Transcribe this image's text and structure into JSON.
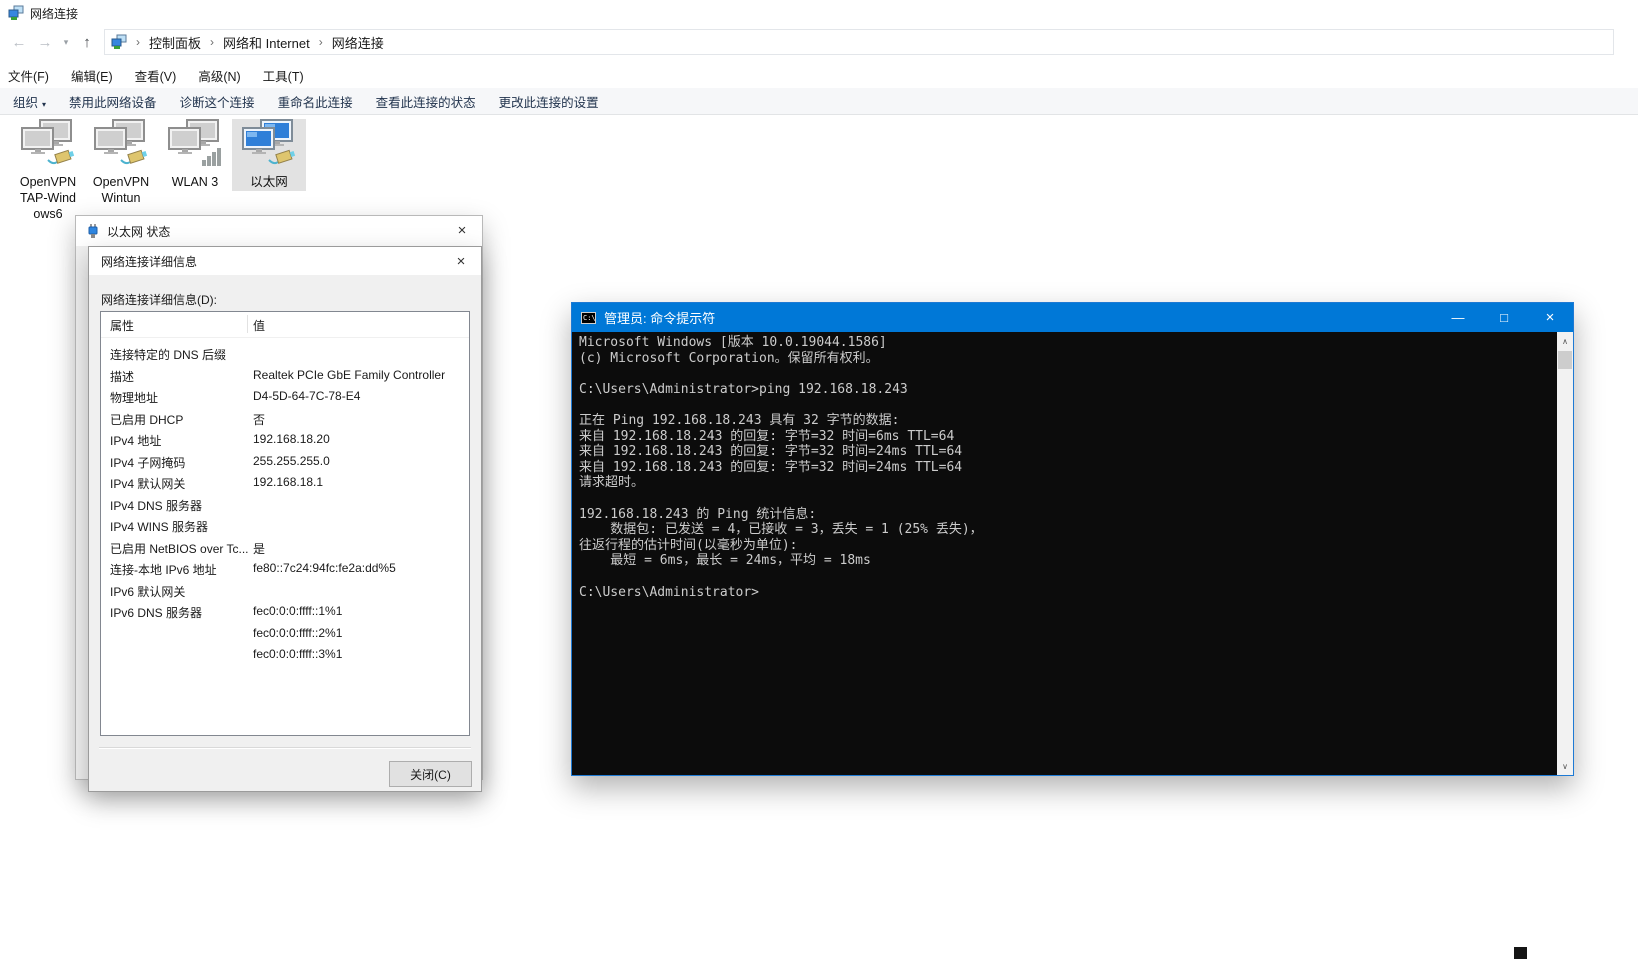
{
  "explorer": {
    "window_title": "网络连接",
    "nav": {
      "breadcrumb": [
        "控制面板",
        "网络和 Internet",
        "网络连接"
      ]
    },
    "menu": [
      "文件(F)",
      "编辑(E)",
      "查看(V)",
      "高级(N)",
      "工具(T)"
    ],
    "toolbar": {
      "organize_label": "组织",
      "commands": [
        "禁用此网络设备",
        "诊断这个连接",
        "重命名此连接",
        "查看此连接的状态",
        "更改此连接的设置"
      ]
    },
    "adapters": [
      {
        "label": "OpenVPN\nTAP-Wind\nows6",
        "kind": "ethernet-disabled",
        "selected": false
      },
      {
        "label": "OpenVPN\nWintun",
        "kind": "ethernet-disabled",
        "selected": false
      },
      {
        "label": "WLAN 3",
        "kind": "wifi-disabled",
        "selected": false
      },
      {
        "label": "以太网",
        "kind": "ethernet-connected",
        "selected": true
      }
    ]
  },
  "status_dialog": {
    "title": "以太网 状态"
  },
  "details_dialog": {
    "title": "网络连接详细信息",
    "field_label": "网络连接详细信息(D):",
    "columns": [
      "属性",
      "值"
    ],
    "rows": [
      {
        "property": "连接特定的 DNS 后缀",
        "value": ""
      },
      {
        "property": "描述",
        "value": "Realtek PCIe GbE Family Controller"
      },
      {
        "property": "物理地址",
        "value": "D4-5D-64-7C-78-E4"
      },
      {
        "property": "已启用 DHCP",
        "value": "否"
      },
      {
        "property": "IPv4 地址",
        "value": "192.168.18.20"
      },
      {
        "property": "IPv4 子网掩码",
        "value": "255.255.255.0"
      },
      {
        "property": "IPv4 默认网关",
        "value": "192.168.18.1"
      },
      {
        "property": "IPv4 DNS 服务器",
        "value": ""
      },
      {
        "property": "IPv4 WINS 服务器",
        "value": ""
      },
      {
        "property": "已启用 NetBIOS over Tc...",
        "value": "是"
      },
      {
        "property": "连接-本地 IPv6 地址",
        "value": "fe80::7c24:94fc:fe2a:dd%5"
      },
      {
        "property": "IPv6 默认网关",
        "value": ""
      },
      {
        "property": "IPv6 DNS 服务器",
        "value": "fec0:0:0:ffff::1%1"
      },
      {
        "property": "",
        "value": "fec0:0:0:ffff::2%1"
      },
      {
        "property": "",
        "value": "fec0:0:0:ffff::3%1"
      }
    ],
    "close_button": "关闭(C)"
  },
  "cmd": {
    "title": "管理员: 命令提示符",
    "icon_text": "C:\\",
    "lines": [
      "Microsoft Windows [版本 10.0.19044.1586]",
      "(c) Microsoft Corporation。保留所有权利。",
      "",
      "C:\\Users\\Administrator>ping 192.168.18.243",
      "",
      "正在 Ping 192.168.18.243 具有 32 字节的数据:",
      "来自 192.168.18.243 的回复: 字节=32 时间=6ms TTL=64",
      "来自 192.168.18.243 的回复: 字节=32 时间=24ms TTL=64",
      "来自 192.168.18.243 的回复: 字节=32 时间=24ms TTL=64",
      "请求超时。",
      "",
      "192.168.18.243 的 Ping 统计信息:",
      "    数据包: 已发送 = 4，已接收 = 3，丢失 = 1 (25% 丢失)，",
      "往返行程的估计时间(以毫秒为单位):",
      "    最短 = 6ms，最长 = 24ms，平均 = 18ms",
      "",
      "C:\\Users\\Administrator>"
    ]
  },
  "icons": {
    "back": "←",
    "forward": "→",
    "dropdown": "▾",
    "up": "↑",
    "chevron": "›",
    "close": "×",
    "minimize": "—",
    "maximize": "□",
    "scroll_up": "∧",
    "scroll_down": "∨",
    "organize_caret": "▾"
  },
  "colors": {
    "cmd_titlebar": "#0078D7",
    "console_bg": "#0C0C0C",
    "console_fg": "#CCCCCC",
    "selection_bg": "#E2E2E2"
  }
}
